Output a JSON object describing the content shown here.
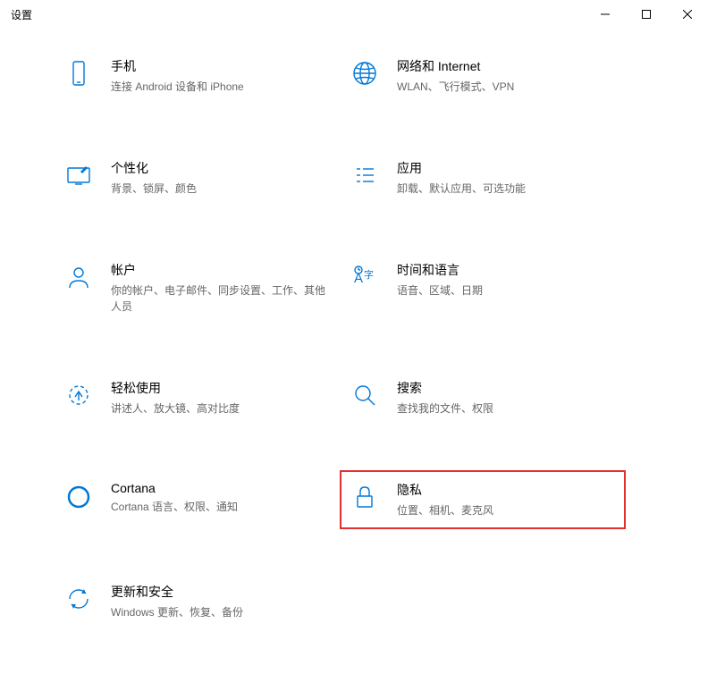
{
  "window": {
    "title": "设置"
  },
  "categories": [
    {
      "icon": "phone-icon",
      "title": "手机",
      "desc": "连接 Android 设备和 iPhone",
      "highlight": false
    },
    {
      "icon": "globe-icon",
      "title": "网络和 Internet",
      "desc": "WLAN、飞行模式、VPN",
      "highlight": false
    },
    {
      "icon": "personalize-icon",
      "title": "个性化",
      "desc": "背景、锁屏、颜色",
      "highlight": false
    },
    {
      "icon": "apps-icon",
      "title": "应用",
      "desc": "卸载、默认应用、可选功能",
      "highlight": false
    },
    {
      "icon": "account-icon",
      "title": "帐户",
      "desc": "你的帐户、电子邮件、同步设置、工作、其他人员",
      "highlight": false
    },
    {
      "icon": "time-lang-icon",
      "title": "时间和语言",
      "desc": "语音、区域、日期",
      "highlight": false
    },
    {
      "icon": "ease-icon",
      "title": "轻松使用",
      "desc": "讲述人、放大镜、高对比度",
      "highlight": false
    },
    {
      "icon": "search-icon",
      "title": "搜索",
      "desc": "查找我的文件、权限",
      "highlight": false
    },
    {
      "icon": "cortana-icon",
      "title": "Cortana",
      "desc": "Cortana 语言、权限、通知",
      "highlight": false
    },
    {
      "icon": "privacy-icon",
      "title": "隐私",
      "desc": "位置、相机、麦克风",
      "highlight": true
    },
    {
      "icon": "update-icon",
      "title": "更新和安全",
      "desc": "Windows 更新、恢复、备份",
      "highlight": false
    }
  ]
}
